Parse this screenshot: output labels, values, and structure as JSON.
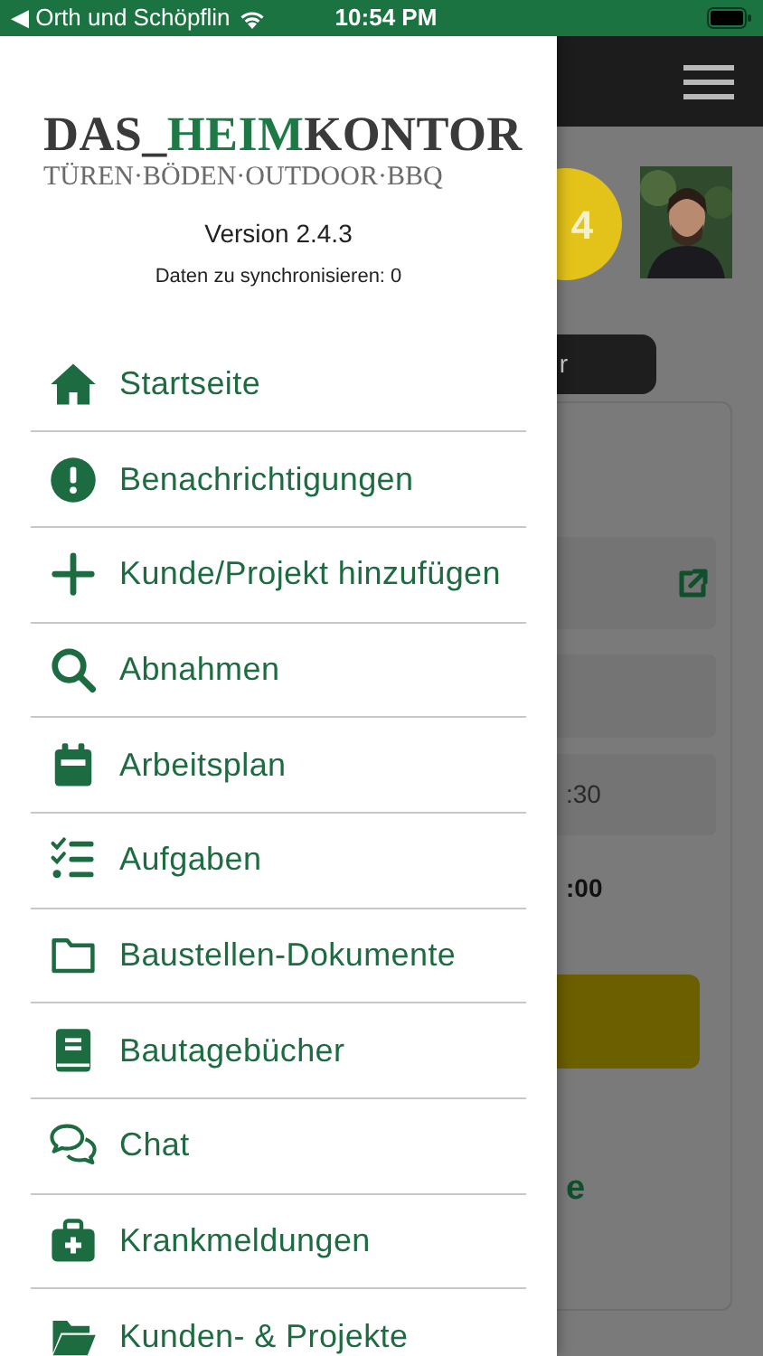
{
  "status_bar": {
    "back_app": "◀ Orth und Schöpflin",
    "time": "10:54 PM"
  },
  "drawer": {
    "logo": {
      "start": "DAS_",
      "accent": "HEIM",
      "end": "KONTOR",
      "tagline": "TÜREN·BÖDEN·OUTDOOR·BBQ"
    },
    "version": "Version 2.4.3",
    "sync_status": "Daten zu synchronisieren: 0",
    "menu_items": [
      {
        "label": "Startseite"
      },
      {
        "label": "Benachrichtigungen"
      },
      {
        "label": "Kunde/Projekt hinzufügen"
      },
      {
        "label": "Abnahmen"
      },
      {
        "label": "Arbeitsplan"
      },
      {
        "label": "Aufgaben"
      },
      {
        "label": "Baustellen-Dokumente"
      },
      {
        "label": "Bautagebücher"
      },
      {
        "label": "Chat"
      },
      {
        "label": "Krankmeldungen"
      },
      {
        "label": "Kunden- & Projekte"
      }
    ]
  },
  "background": {
    "badge": "4",
    "button": "r",
    "time_1": ":30",
    "time_2": ":00",
    "heading": "e"
  }
}
